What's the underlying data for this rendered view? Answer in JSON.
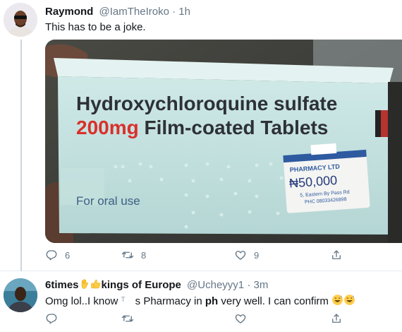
{
  "tweets": [
    {
      "name": "Raymond",
      "handle": "@IamTheIroko",
      "separator": "·",
      "time": "1h",
      "text": "This has to be a joke.",
      "media": {
        "title_line1": "Hydroxychloroquine sulfate",
        "dose": "200mg",
        "title_line2_rest": " Film-coated Tablets",
        "subtitle": "For oral use",
        "sticker_company": "PHARMACY LTD",
        "sticker_price": "₦50,000",
        "sticker_addr1": "5, Eastern By Pass Rd",
        "sticker_addr2": "PHC 08033426898"
      },
      "replies": "6",
      "retweets": "8",
      "likes": "9"
    },
    {
      "name": "6times",
      "name_rest": "kings of Europe",
      "handle": "@Ucheyyy1",
      "separator": "·",
      "time": "3m",
      "text_a": "Omg lol..I know ",
      "text_b": "T",
      "text_c": "s Pharmacy in ",
      "text_d": "ph",
      "text_e": " very well. I can confirm "
    }
  ],
  "colors": {
    "accent": "#1da1f2",
    "secondary_text": "#657786",
    "divider": "#e6ecf0",
    "dose_red": "#d9302b",
    "box_teal": "#bfe0df"
  },
  "icons": [
    "reply-icon",
    "retweet-icon",
    "like-icon",
    "share-icon",
    "waving-hand-emoji",
    "thumbs-up-emoji",
    "grinning-sweat-emoji"
  ]
}
